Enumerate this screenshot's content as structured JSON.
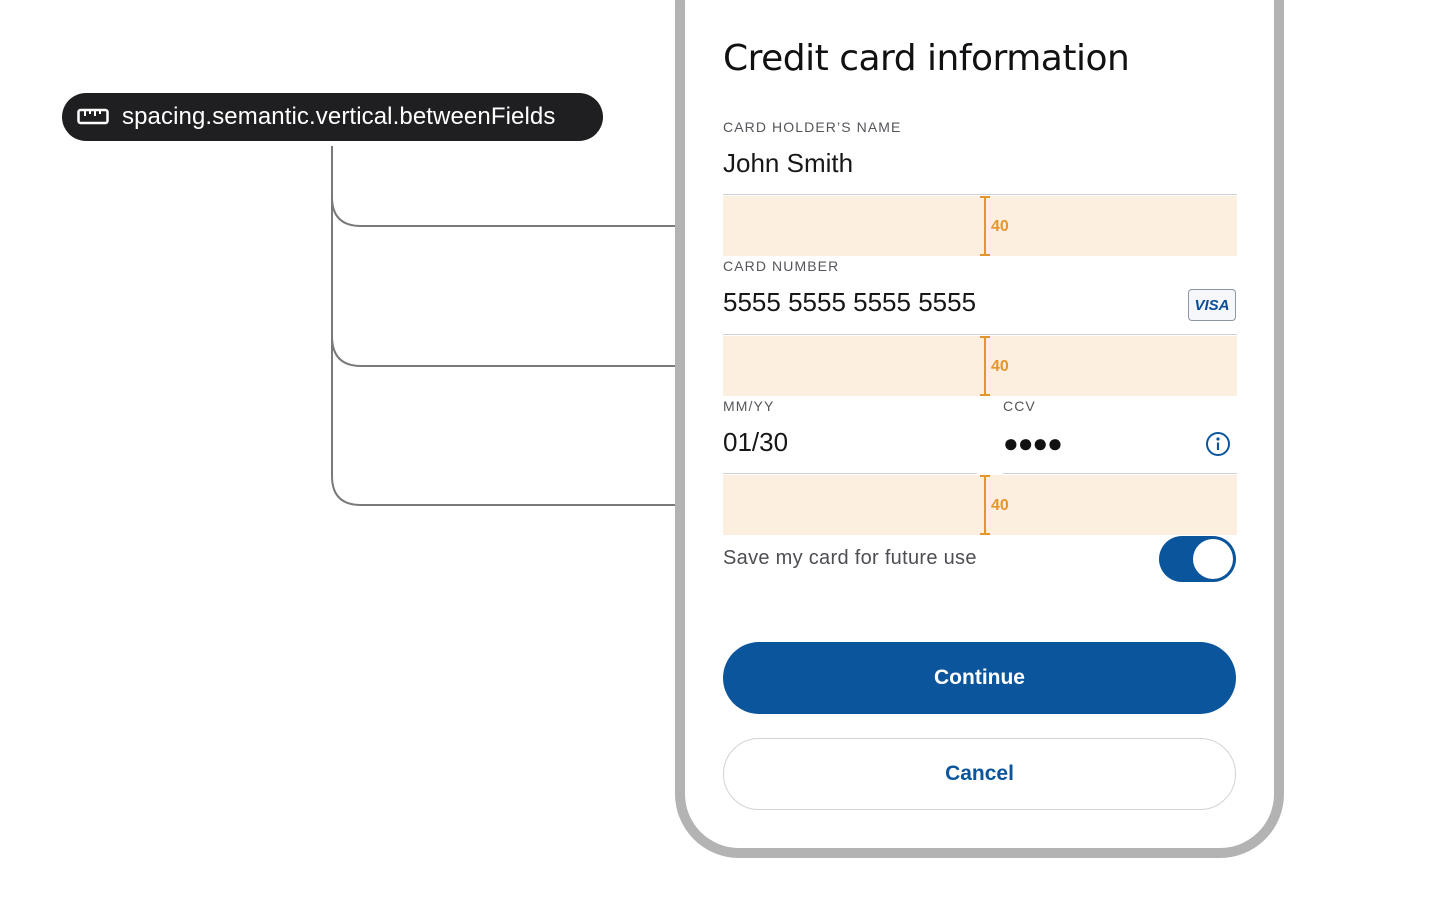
{
  "token": {
    "icon": "ruler-icon",
    "name": "spacing.semantic.vertical.betweenFields"
  },
  "form": {
    "title": "Credit card information",
    "card_holder": {
      "label": "CARD HOLDER’S NAME",
      "value": "John Smith"
    },
    "card_number": {
      "label": "CARD NUMBER",
      "value": "5555 5555 5555 5555",
      "brand": "VISA"
    },
    "expiry": {
      "label": "MM/YY",
      "value": "01/30"
    },
    "ccv": {
      "label": "CCV",
      "value": "●●●●",
      "icon": "info-icon"
    },
    "save_card": {
      "label": "Save my card for future use",
      "enabled": true
    },
    "continue_label": "Continue",
    "cancel_label": "Cancel"
  },
  "spacing_annotations": [
    "40",
    "40",
    "40"
  ],
  "colors": {
    "primary": "#0b559c",
    "annotation": "#e5952e",
    "annotation_fill": "#fcefdf",
    "pill": "#1f1f21",
    "frame": "#b3b3b3"
  }
}
